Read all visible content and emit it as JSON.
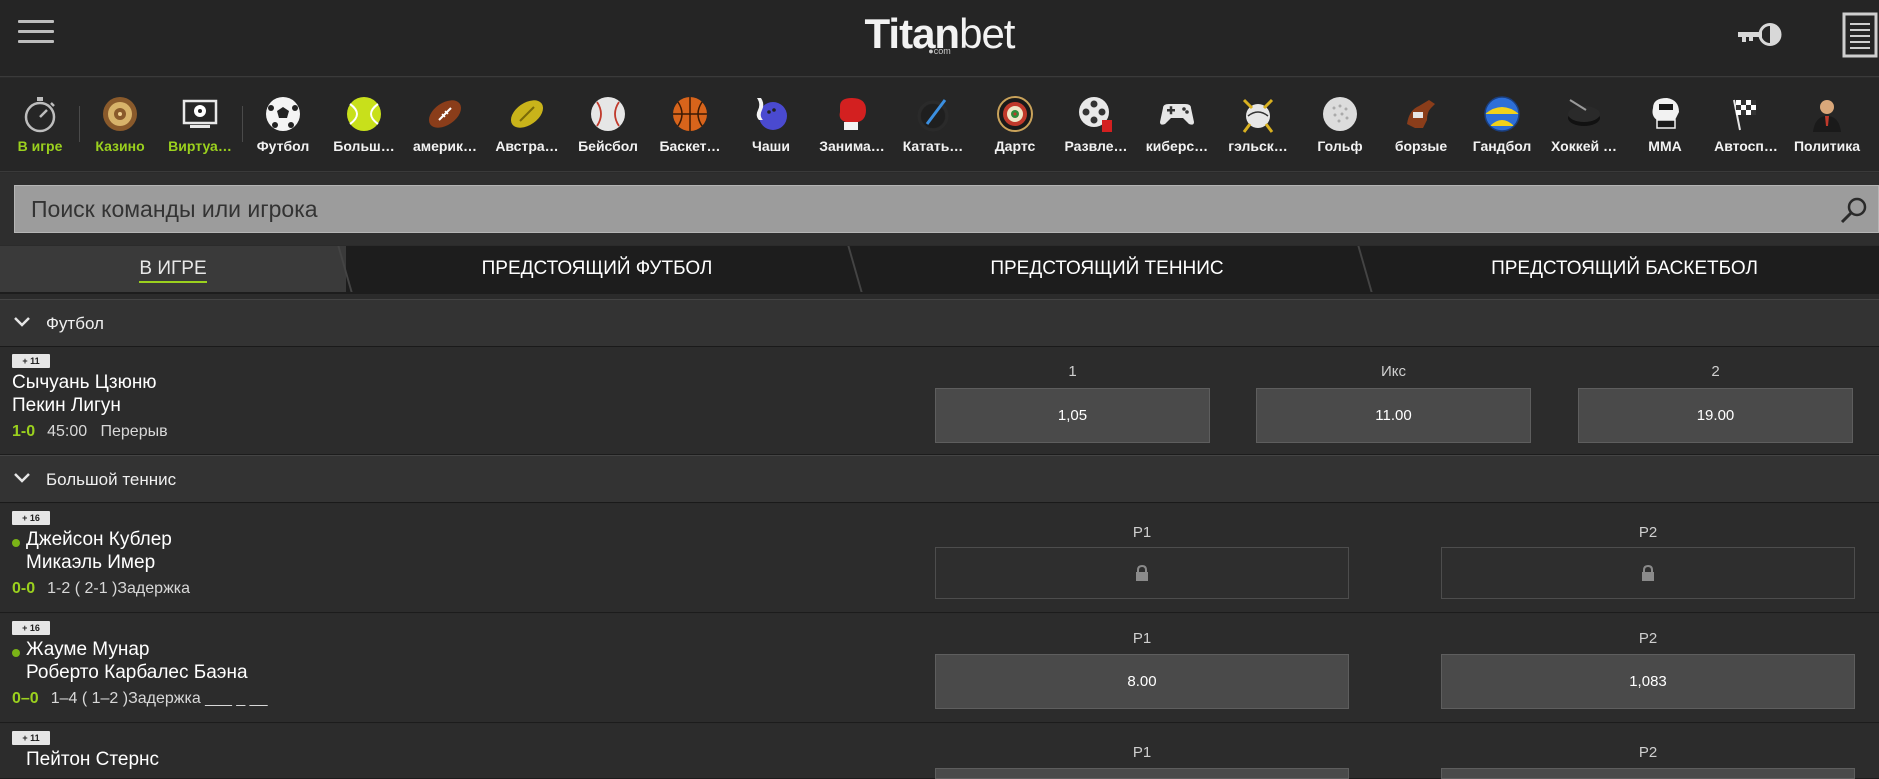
{
  "header": {
    "logo_bold": "Titan",
    "logo_light": "bet",
    "logo_sub": "●com"
  },
  "sports": [
    {
      "label": "В игре",
      "icon": "stopwatch-icon",
      "green": true
    },
    {
      "label": "Казино",
      "icon": "roulette-icon",
      "green": true
    },
    {
      "label": "Виртуа…",
      "icon": "virtual-sports-icon",
      "green": true
    },
    {
      "label": "Футбол",
      "icon": "soccer-ball-icon"
    },
    {
      "label": "Больш…",
      "icon": "tennis-ball-icon"
    },
    {
      "label": "америк…",
      "icon": "american-football-icon"
    },
    {
      "label": "Австра…",
      "icon": "aussie-rules-ball-icon"
    },
    {
      "label": "Бейсбол",
      "icon": "baseball-icon"
    },
    {
      "label": "Баскет…",
      "icon": "basketball-icon"
    },
    {
      "label": "Чаши",
      "icon": "bowling-icon"
    },
    {
      "label": "Занима…",
      "icon": "boxing-glove-icon"
    },
    {
      "label": "Катать…",
      "icon": "ice-skating-icon"
    },
    {
      "label": "Дартс",
      "icon": "dartboard-icon"
    },
    {
      "label": "Развле…",
      "icon": "film-reel-icon"
    },
    {
      "label": "киберс…",
      "icon": "gamepad-icon"
    },
    {
      "label": "гэльск…",
      "icon": "gaelic-sports-icon"
    },
    {
      "label": "Гольф",
      "icon": "golf-ball-icon"
    },
    {
      "label": "борзые",
      "icon": "greyhound-icon"
    },
    {
      "label": "Гандбол",
      "icon": "handball-icon"
    },
    {
      "label": "Хоккей …",
      "icon": "hockey-puck-icon"
    },
    {
      "label": "MMA",
      "icon": "mma-glove-icon"
    },
    {
      "label": "Автосп…",
      "icon": "checkered-flag-icon"
    },
    {
      "label": "Политика",
      "icon": "politician-icon"
    }
  ],
  "search": {
    "placeholder": "Поиск команды или игрока"
  },
  "tabs": [
    {
      "label": "В ИГРЕ"
    },
    {
      "label": "ПРЕДСТОЯЩИЙ ФУТБОЛ"
    },
    {
      "label": "ПРЕДСТОЯЩИЙ ТЕННИС"
    },
    {
      "label": "ПРЕДСТОЯЩИЙ БАСКЕТБОЛ"
    }
  ],
  "sections": [
    {
      "title": "Футбол",
      "events": [
        {
          "more": "+ 11",
          "team1": "Сычуань Цзюню",
          "team2": "Пекин Лигун",
          "score": "1-0",
          "status": "45:00   Перерыв",
          "labels": [
            "1",
            "Икс",
            "2"
          ],
          "odds": [
            "1,05",
            "11.00",
            "19.00"
          ]
        }
      ]
    },
    {
      "title": "Большой теннис",
      "events": [
        {
          "more": "+ 16",
          "team1": "Джейсон Кублер",
          "team2": "Микаэль Имер",
          "score": "0-0",
          "status": "1-2 ( 2-1 )Задержка",
          "labels": [
            "P1",
            "P2"
          ],
          "odds": [
            "",
            ""
          ],
          "locked": true
        },
        {
          "more": "+ 16",
          "team1": "Жауме Мунар",
          "team2": "Роберто Карбалес Баэна",
          "score": "0–0",
          "status": "1–4 ( 1–2 )Задержка ___ _ __",
          "labels": [
            "P1",
            "P2"
          ],
          "odds": [
            "8.00",
            "1,083"
          ]
        },
        {
          "more": "+ 11",
          "team1": "Пейтон Стернс",
          "team2": "",
          "labels": [
            "P1",
            "P2"
          ],
          "odds": [
            "",
            ""
          ]
        }
      ]
    }
  ]
}
